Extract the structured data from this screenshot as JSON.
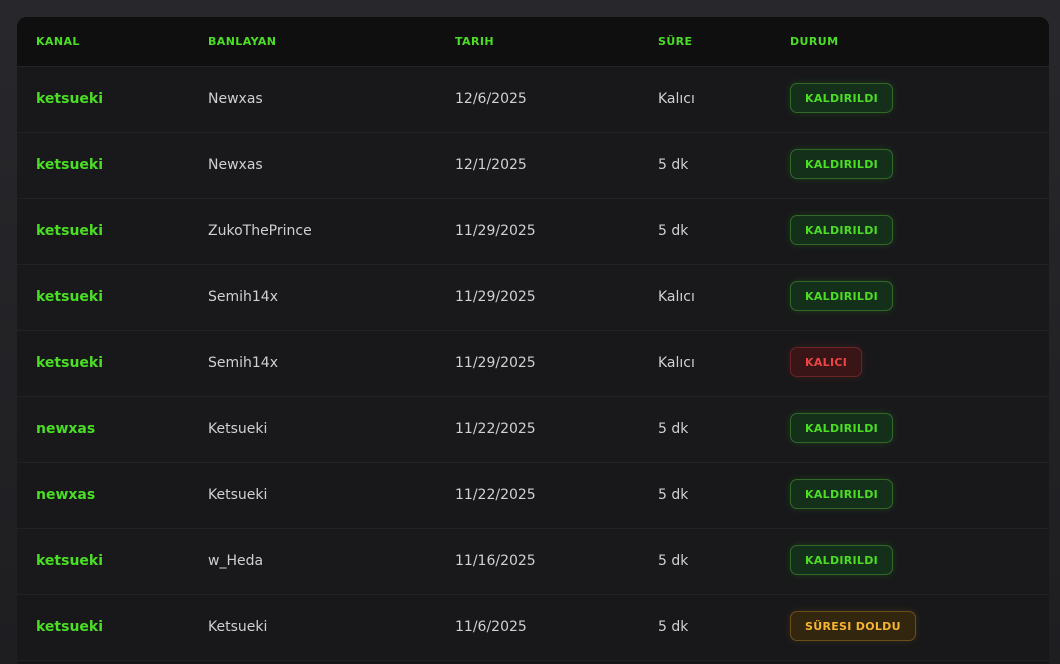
{
  "table": {
    "headers": {
      "kanal": "KANAL",
      "banlayan": "BANLAYAN",
      "tarih": "TARIH",
      "sure": "SÜRE",
      "durum": "DURUM"
    },
    "rows": [
      {
        "kanal": "ketsueki",
        "banlayan": "Newxas",
        "tarih": "12/6/2025",
        "sure": "Kalıcı",
        "durum": "KALDIRILDI",
        "status": "green"
      },
      {
        "kanal": "ketsueki",
        "banlayan": "Newxas",
        "tarih": "12/1/2025",
        "sure": "5 dk",
        "durum": "KALDIRILDI",
        "status": "green"
      },
      {
        "kanal": "ketsueki",
        "banlayan": "ZukoThePrince",
        "tarih": "11/29/2025",
        "sure": "5 dk",
        "durum": "KALDIRILDI",
        "status": "green"
      },
      {
        "kanal": "ketsueki",
        "banlayan": "Semih14x",
        "tarih": "11/29/2025",
        "sure": "Kalıcı",
        "durum": "KALDIRILDI",
        "status": "green"
      },
      {
        "kanal": "ketsueki",
        "banlayan": "Semih14x",
        "tarih": "11/29/2025",
        "sure": "Kalıcı",
        "durum": "KALICI",
        "status": "red"
      },
      {
        "kanal": "newxas",
        "banlayan": "Ketsueki",
        "tarih": "11/22/2025",
        "sure": "5 dk",
        "durum": "KALDIRILDI",
        "status": "green"
      },
      {
        "kanal": "newxas",
        "banlayan": "Ketsueki",
        "tarih": "11/22/2025",
        "sure": "5 dk",
        "durum": "KALDIRILDI",
        "status": "green"
      },
      {
        "kanal": "ketsueki",
        "banlayan": "w_Heda",
        "tarih": "11/16/2025",
        "sure": "5 dk",
        "durum": "KALDIRILDI",
        "status": "green"
      },
      {
        "kanal": "ketsueki",
        "banlayan": "Ketsueki",
        "tarih": "11/6/2025",
        "sure": "5 dk",
        "durum": "SÜRESI DOLDU",
        "status": "amber"
      }
    ]
  },
  "colors": {
    "accent": "#4ade25",
    "danger": "#ef4444",
    "warning": "#f5b530",
    "background": "#151517"
  }
}
